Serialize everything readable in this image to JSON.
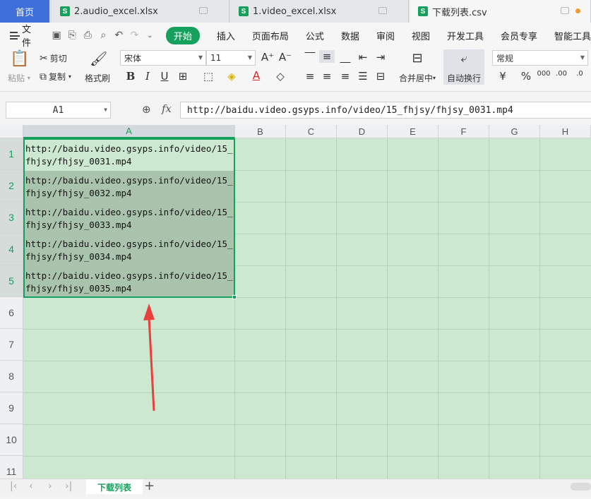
{
  "tabs": {
    "home": "首页",
    "files": [
      {
        "label": "2.audio_excel.xlsx"
      },
      {
        "label": "1.video_excel.xlsx"
      },
      {
        "label": "下载列表.csv"
      }
    ]
  },
  "menu": {
    "file": "文件",
    "items": [
      "开始",
      "插入",
      "页面布局",
      "公式",
      "数据",
      "审阅",
      "视图",
      "开发工具",
      "会员专享",
      "智能工具"
    ]
  },
  "ribbon": {
    "paste": "粘贴",
    "cut": "剪切",
    "copy": "复制",
    "format_painter": "格式刷",
    "font_name": "宋体",
    "font_size": "11",
    "merge_center": "合并居中",
    "wrap_text": "自动换行",
    "number_format": "常规"
  },
  "formula_bar": {
    "name_box": "A1",
    "fx": "fx",
    "value": "http://baidu.video.gsyps.info/video/15_fhjsy/fhjsy_0031.mp4"
  },
  "columns": [
    "A",
    "B",
    "C",
    "D",
    "E",
    "F",
    "G",
    "H"
  ],
  "rows": [
    "1",
    "2",
    "3",
    "4",
    "5",
    "6",
    "7",
    "8",
    "9",
    "10",
    "11"
  ],
  "cells": [
    "http://baidu.video.gsyps.info/video/15_fhjsy/fhjsy_0031.mp4",
    "http://baidu.video.gsyps.info/video/15_fhjsy/fhjsy_0032.mp4",
    "http://baidu.video.gsyps.info/video/15_fhjsy/fhjsy_0033.mp4",
    "http://baidu.video.gsyps.info/video/15_fhjsy/fhjsy_0034.mp4",
    "http://baidu.video.gsyps.info/video/15_fhjsy/fhjsy_0035.mp4"
  ],
  "sheet": {
    "name": "下载列表"
  },
  "colors": {
    "accent": "#16a05d",
    "grid_bg": "#cde8d0",
    "annotation": "#e8413b",
    "home_tab": "#3f6fd8"
  }
}
